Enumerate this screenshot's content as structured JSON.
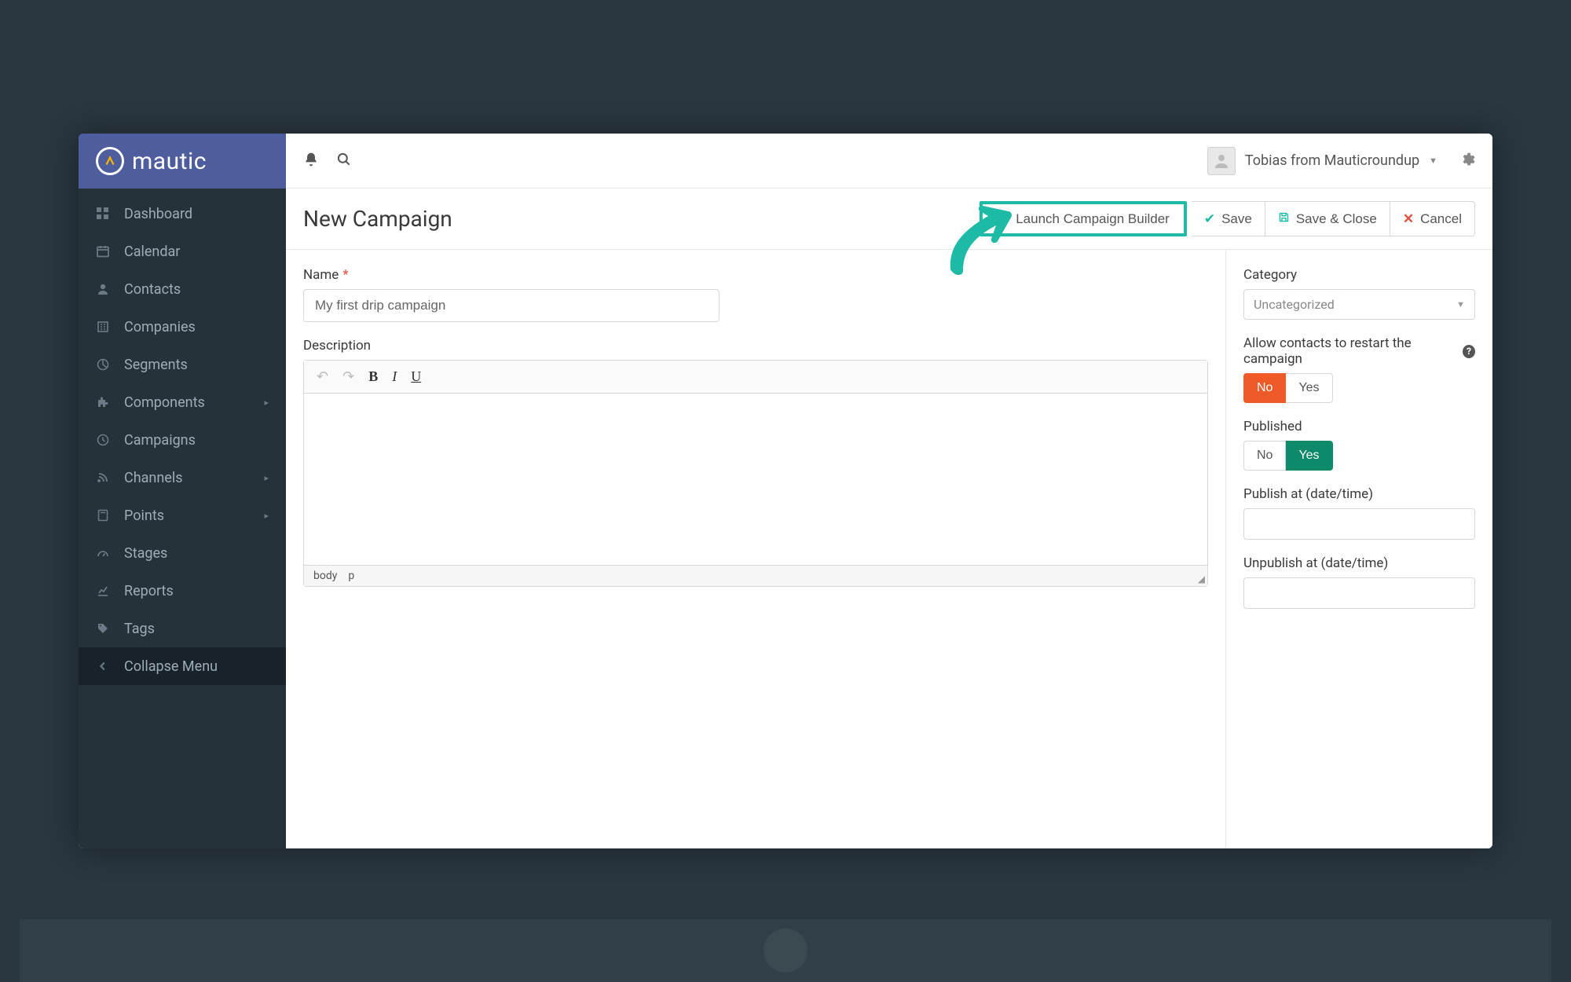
{
  "brand": "mautic",
  "sidebar": {
    "items": [
      {
        "label": "Dashboard",
        "icon": "grid"
      },
      {
        "label": "Calendar",
        "icon": "calendar"
      },
      {
        "label": "Contacts",
        "icon": "user"
      },
      {
        "label": "Companies",
        "icon": "building"
      },
      {
        "label": "Segments",
        "icon": "pie"
      },
      {
        "label": "Components",
        "icon": "puzzle",
        "caret": true
      },
      {
        "label": "Campaigns",
        "icon": "clock"
      },
      {
        "label": "Channels",
        "icon": "rss",
        "caret": true
      },
      {
        "label": "Points",
        "icon": "calculator",
        "caret": true
      },
      {
        "label": "Stages",
        "icon": "gauge"
      },
      {
        "label": "Reports",
        "icon": "chart"
      },
      {
        "label": "Tags",
        "icon": "tag"
      }
    ],
    "collapse": "Collapse Menu"
  },
  "topbar": {
    "user": "Tobias from Mauticroundup"
  },
  "page": {
    "title": "New Campaign"
  },
  "actions": {
    "builder": "Launch Campaign Builder",
    "save": "Save",
    "save_close": "Save & Close",
    "cancel": "Cancel"
  },
  "form": {
    "name_label": "Name",
    "name_value": "My first drip campaign",
    "desc_label": "Description",
    "editor_path_body": "body",
    "editor_path_p": "p"
  },
  "side": {
    "category_label": "Category",
    "category_value": "Uncategorized",
    "restart_label": "Allow contacts to restart the campaign",
    "no": "No",
    "yes": "Yes",
    "published_label": "Published",
    "publish_at_label": "Publish at (date/time)",
    "unpublish_at_label": "Unpublish at (date/time)"
  }
}
